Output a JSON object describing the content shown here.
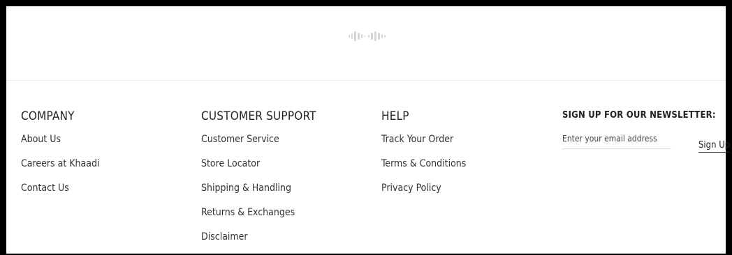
{
  "logo": {
    "name": "khaadi-logo",
    "color": "#d9d9d9"
  },
  "columns": {
    "company": {
      "title": "COMPANY",
      "links": [
        "About Us",
        "Careers at Khaadi",
        "Contact Us"
      ]
    },
    "support": {
      "title": "CUSTOMER SUPPORT",
      "links": [
        "Customer Service",
        "Store Locator",
        "Shipping & Handling",
        "Returns & Exchanges",
        "Disclaimer"
      ]
    },
    "help": {
      "title": "HELP",
      "links": [
        "Track Your Order",
        "Terms & Conditions",
        "Privacy Policy"
      ]
    }
  },
  "newsletter": {
    "title": "SIGN UP FOR OUR NEWSLETTER:",
    "email_placeholder": "Enter your email address",
    "email_value": "",
    "button_label": "Sign Up"
  }
}
